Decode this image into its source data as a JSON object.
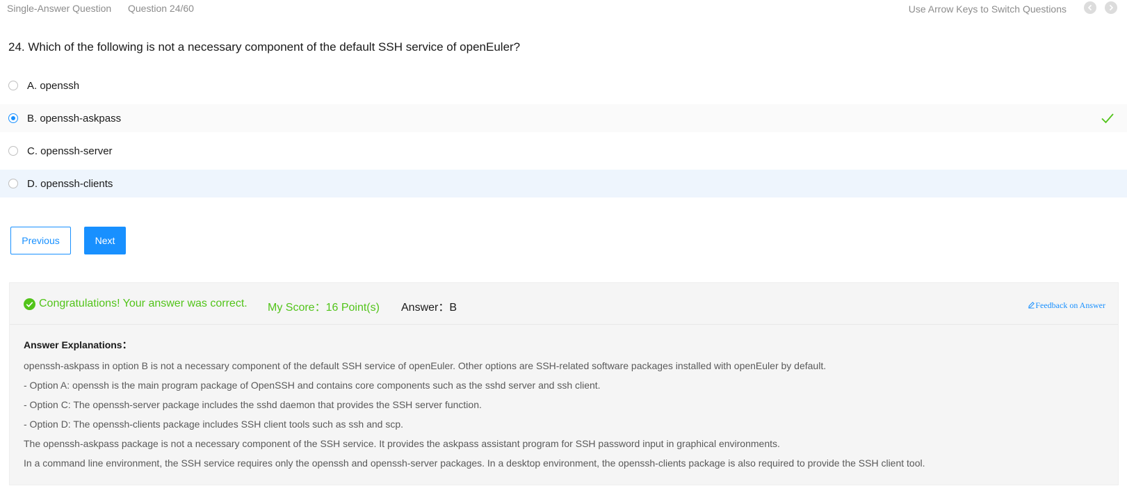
{
  "header": {
    "question_type": "Single-Answer Question",
    "question_progress": "Question 24/60",
    "nav_hint": "Use Arrow Keys to Switch Questions",
    "prev_icon": "chevron-left-icon",
    "next_icon": "chevron-right-icon"
  },
  "question": {
    "text": "24. Which of the following is not a necessary component of the default SSH service of openEuler?",
    "options": [
      {
        "label": "A. openssh",
        "selected": false
      },
      {
        "label": "B. openssh-askpass",
        "selected": true,
        "correct": true
      },
      {
        "label": "C. openssh-server",
        "selected": false
      },
      {
        "label": "D. openssh-clients",
        "selected": false
      }
    ]
  },
  "buttons": {
    "previous": "Previous",
    "next": "Next"
  },
  "result": {
    "status": "Congratulations! Your answer was correct.",
    "score": "My Score：16 Point(s)",
    "answer": "Answer：B",
    "feedback": "Feedback on Answer",
    "status_color": "#52c41a",
    "accent_color": "#1890ff"
  },
  "explanation": {
    "heading": "Answer Explanations：",
    "lines": [
      "openssh-askpass in option B is not a necessary component of the default SSH service of openEuler. Other options are SSH-related software packages installed with openEuler by default.",
      "- Option A: openssh is the main program package of OpenSSH and contains core components such as the sshd server and ssh client.",
      "- Option C: The openssh-server package includes the sshd daemon that provides the SSH server function.",
      "- Option D: The openssh-clients package includes SSH client tools such as ssh and scp.",
      "The openssh-askpass package is not a necessary component of the SSH service. It provides the askpass assistant program for SSH password input in graphical environments.",
      "In a command line environment, the SSH service requires only the openssh and openssh-server packages. In a desktop environment, the openssh-clients package is also required to provide the SSH client tool."
    ]
  }
}
